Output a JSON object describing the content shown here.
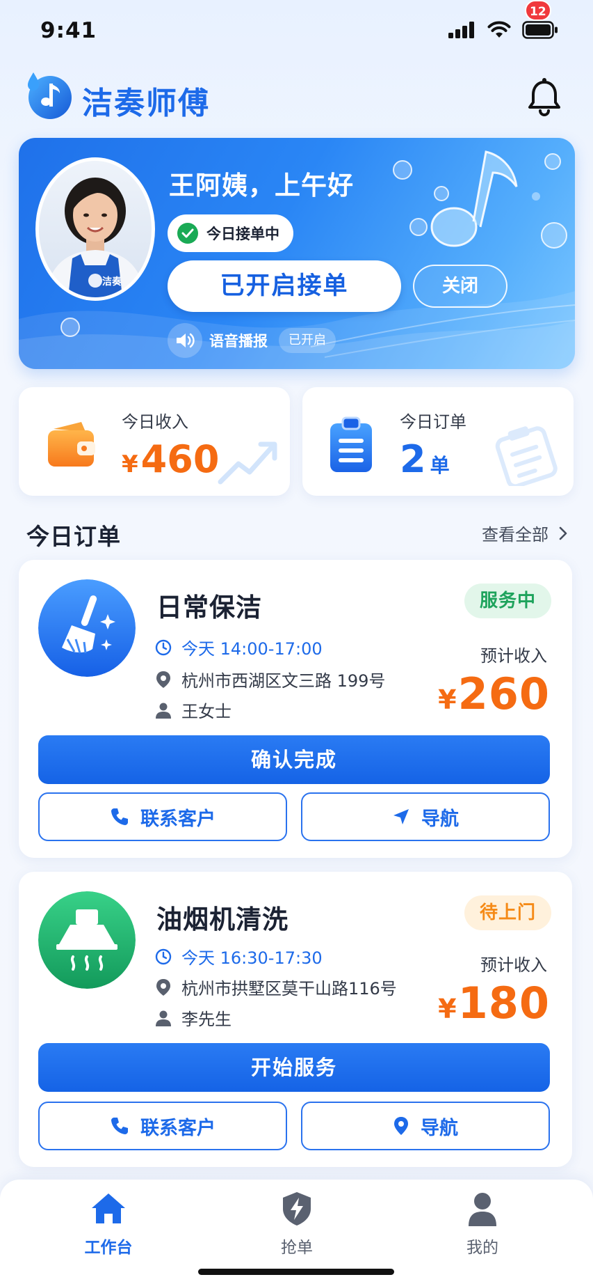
{
  "status_bar": {
    "time": "9:41"
  },
  "header": {
    "app_name": "洁奏师傅",
    "notification_count": "12"
  },
  "hero": {
    "greeting": "王阿姨，上午好",
    "status_chip": "今日接单中",
    "accept_button": "已开启接单",
    "close_button": "关闭",
    "voice_label": "语音播报",
    "voice_state": "已开启",
    "apron_brand": "洁奏"
  },
  "stats": {
    "income": {
      "label": "今日收入",
      "currency": "¥",
      "value": "460"
    },
    "orders": {
      "label": "今日订单",
      "value": "2",
      "unit": "单"
    }
  },
  "section": {
    "title": "今日订单",
    "view_all": "查看全部"
  },
  "orders": [
    {
      "title": "日常保洁",
      "status": "服务中",
      "time": "今天 14:00-17:00",
      "address": "杭州市西湖区文三路 199号",
      "customer": "王女士",
      "income_label": "预计收入",
      "currency": "¥",
      "amount": "260",
      "primary_action": "确认完成",
      "contact_action": "联系客户",
      "nav_action": "导航"
    },
    {
      "title": "油烟机清洗",
      "status": "待上门",
      "time": "今天 16:30-17:30",
      "address": "杭州市拱墅区莫干山路116号",
      "customer": "李先生",
      "income_label": "预计收入",
      "currency": "¥",
      "amount": "180",
      "primary_action": "开始服务",
      "contact_action": "联系客户",
      "nav_action": "导航"
    }
  ],
  "bottom_nav": [
    {
      "label": "工作台",
      "icon": "home-icon",
      "active": true
    },
    {
      "label": "抢单",
      "icon": "lightning-icon",
      "active": false
    },
    {
      "label": "我的",
      "icon": "person-icon",
      "active": false
    }
  ],
  "colors": {
    "primary": "#1d6ae9",
    "accent_orange": "#f56b12",
    "status_green": "#1ea35c",
    "status_orange": "#f58a17"
  }
}
